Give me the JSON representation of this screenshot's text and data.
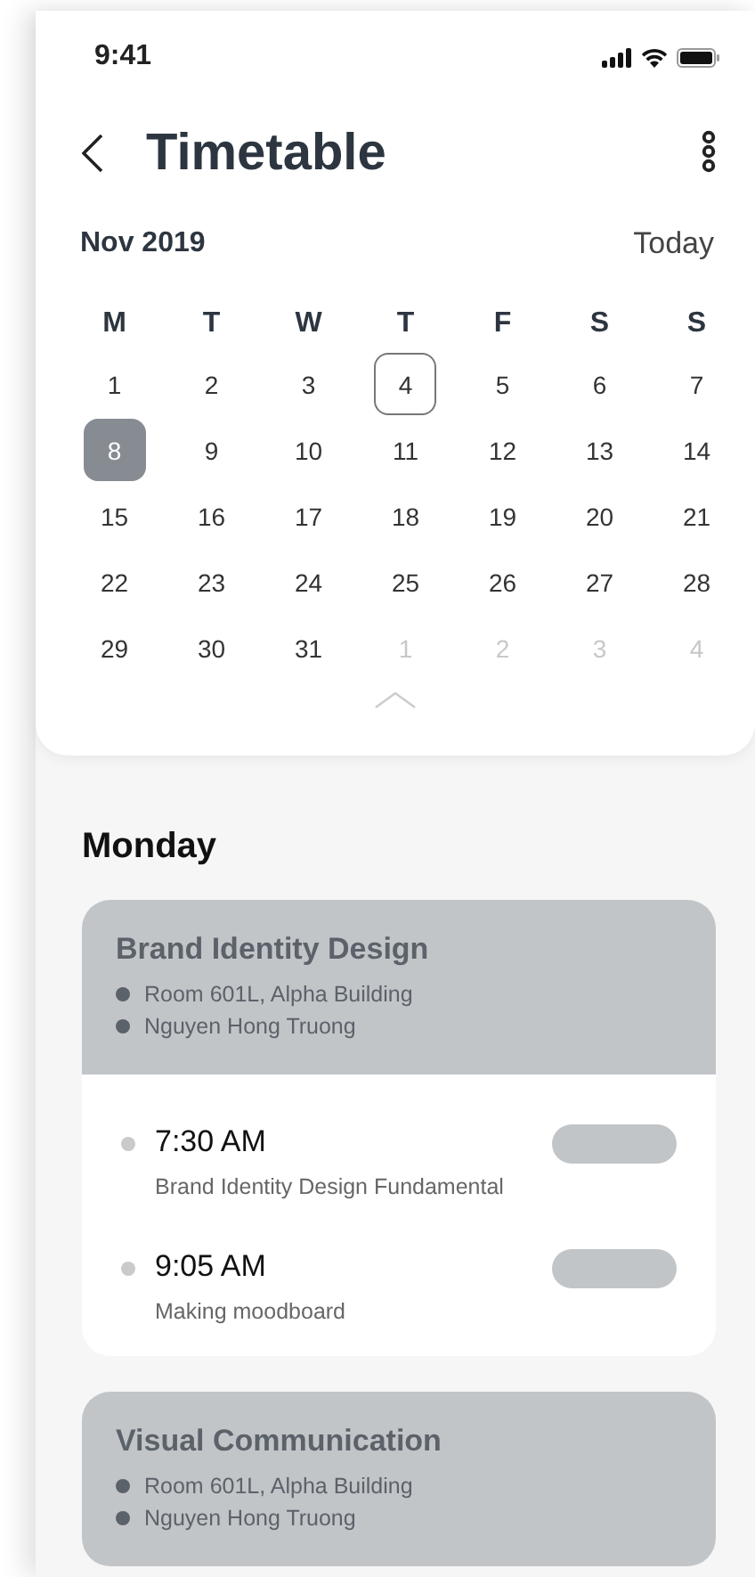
{
  "status_bar": {
    "time": "9:41"
  },
  "header": {
    "title": "Timetable"
  },
  "calendar": {
    "month": "Nov 2019",
    "today_link": "Today",
    "weekdays": [
      "M",
      "T",
      "W",
      "T",
      "F",
      "S",
      "S"
    ],
    "days": [
      {
        "label": "1",
        "in_month": true,
        "today": false,
        "selected": false
      },
      {
        "label": "2",
        "in_month": true,
        "today": false,
        "selected": false
      },
      {
        "label": "3",
        "in_month": true,
        "today": false,
        "selected": false
      },
      {
        "label": "4",
        "in_month": true,
        "today": true,
        "selected": false
      },
      {
        "label": "5",
        "in_month": true,
        "today": false,
        "selected": false
      },
      {
        "label": "6",
        "in_month": true,
        "today": false,
        "selected": false
      },
      {
        "label": "7",
        "in_month": true,
        "today": false,
        "selected": false
      },
      {
        "label": "8",
        "in_month": true,
        "today": false,
        "selected": true
      },
      {
        "label": "9",
        "in_month": true,
        "today": false,
        "selected": false
      },
      {
        "label": "10",
        "in_month": true,
        "today": false,
        "selected": false
      },
      {
        "label": "11",
        "in_month": true,
        "today": false,
        "selected": false
      },
      {
        "label": "12",
        "in_month": true,
        "today": false,
        "selected": false
      },
      {
        "label": "13",
        "in_month": true,
        "today": false,
        "selected": false
      },
      {
        "label": "14",
        "in_month": true,
        "today": false,
        "selected": false
      },
      {
        "label": "15",
        "in_month": true,
        "today": false,
        "selected": false
      },
      {
        "label": "16",
        "in_month": true,
        "today": false,
        "selected": false
      },
      {
        "label": "17",
        "in_month": true,
        "today": false,
        "selected": false
      },
      {
        "label": "18",
        "in_month": true,
        "today": false,
        "selected": false
      },
      {
        "label": "19",
        "in_month": true,
        "today": false,
        "selected": false
      },
      {
        "label": "20",
        "in_month": true,
        "today": false,
        "selected": false
      },
      {
        "label": "21",
        "in_month": true,
        "today": false,
        "selected": false
      },
      {
        "label": "22",
        "in_month": true,
        "today": false,
        "selected": false
      },
      {
        "label": "23",
        "in_month": true,
        "today": false,
        "selected": false
      },
      {
        "label": "24",
        "in_month": true,
        "today": false,
        "selected": false
      },
      {
        "label": "25",
        "in_month": true,
        "today": false,
        "selected": false
      },
      {
        "label": "26",
        "in_month": true,
        "today": false,
        "selected": false
      },
      {
        "label": "27",
        "in_month": true,
        "today": false,
        "selected": false
      },
      {
        "label": "28",
        "in_month": true,
        "today": false,
        "selected": false
      },
      {
        "label": "29",
        "in_month": true,
        "today": false,
        "selected": false
      },
      {
        "label": "30",
        "in_month": true,
        "today": false,
        "selected": false
      },
      {
        "label": "31",
        "in_month": true,
        "today": false,
        "selected": false
      },
      {
        "label": "1",
        "in_month": false,
        "today": false,
        "selected": false
      },
      {
        "label": "2",
        "in_month": false,
        "today": false,
        "selected": false
      },
      {
        "label": "3",
        "in_month": false,
        "today": false,
        "selected": false
      },
      {
        "label": "4",
        "in_month": false,
        "today": false,
        "selected": false
      }
    ]
  },
  "schedule": {
    "day": "Monday",
    "courses": [
      {
        "title": "Brand Identity Design",
        "details": [
          "Room 601L, Alpha Building",
          "Nguyen Hong Truong"
        ],
        "sessions": [
          {
            "time": "7:30 AM",
            "topic": "Brand Identity Design Fundamental"
          },
          {
            "time": "9:05 AM",
            "topic": "Making moodboard"
          }
        ]
      },
      {
        "title": "Visual Communication",
        "details": [
          "Room 601L, Alpha Building",
          "Nguyen Hong Truong"
        ]
      }
    ]
  }
}
